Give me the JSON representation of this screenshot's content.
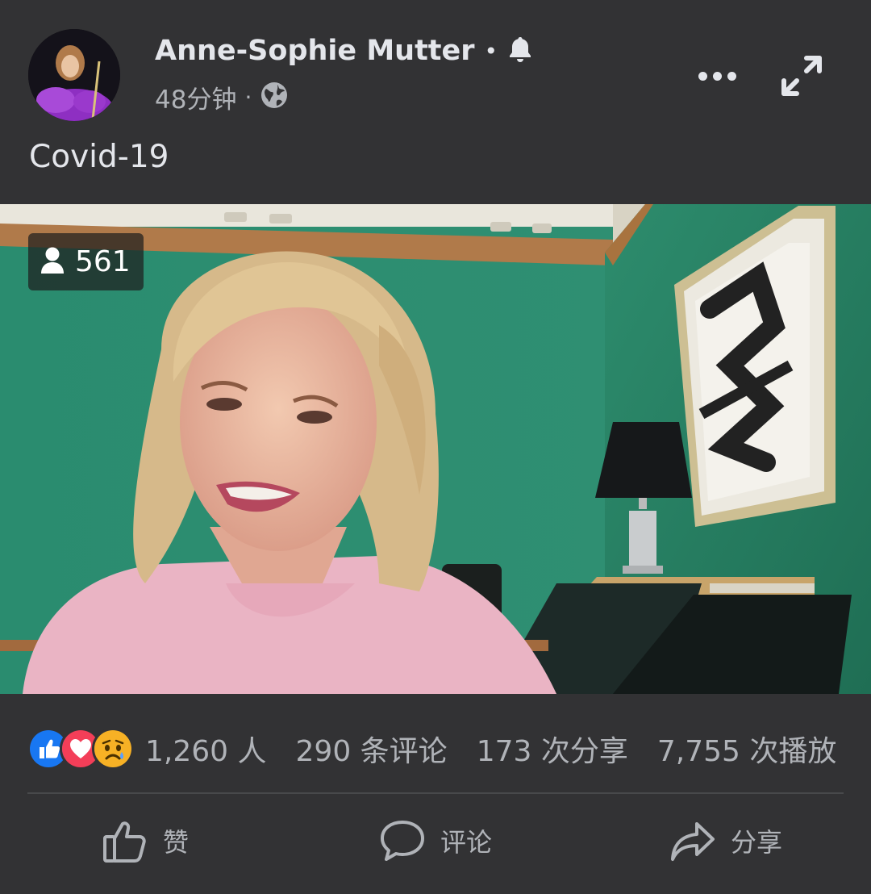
{
  "post": {
    "author": "Anne-Sophie Mutter",
    "time": "48分钟",
    "text": "Covid-19",
    "icons": {
      "notify": "bell-icon",
      "privacy": "globe-icon",
      "more": "more-options-icon",
      "expand": "expand-icon"
    }
  },
  "video": {
    "viewers": "561",
    "viewer_icon": "person-icon"
  },
  "stats": {
    "reactions": [
      "like",
      "love",
      "sad"
    ],
    "reaction_count": "1,260 人",
    "comments": "290 条评论",
    "shares": "173 次分享",
    "views": "7,755 次播放"
  },
  "actions": {
    "like": "赞",
    "comment": "评论",
    "share": "分享"
  },
  "colors": {
    "background": "#323234",
    "text": "#e4e6eb",
    "secondary_text": "#b0b3b8",
    "like_blue": "#1877f2",
    "love_red": "#f33e58",
    "sad_yellow": "#f7b125"
  }
}
